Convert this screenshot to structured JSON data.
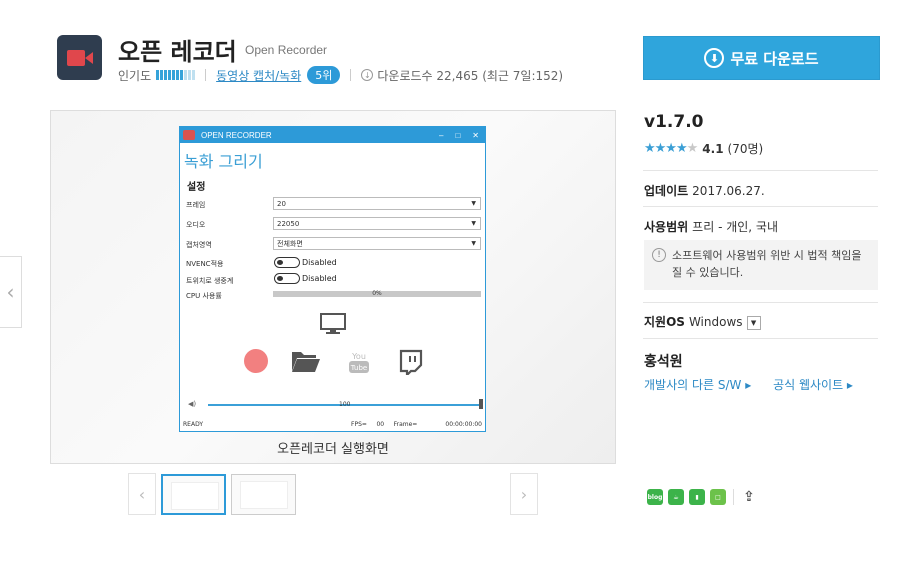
{
  "app": {
    "title": "오픈 레코더",
    "subtitle": "Open Recorder",
    "popularity_label": "인기도",
    "category": "동영상 캡처/녹화",
    "rank": "5위",
    "downloads_label": "다운로드수 22,465 (최근 7일:152)"
  },
  "download_button": {
    "label": "무료 다운로드"
  },
  "screenshot": {
    "caption": "오픈레코더 실행화면",
    "window": {
      "title": "OPEN RECORDER",
      "heading": "녹화 그리기",
      "settings_title": "설정",
      "rows": {
        "frame_label": "프레임",
        "frame_value": "20",
        "audio_label": "오디오",
        "audio_value": "22050",
        "capture_label": "캡처영역",
        "capture_value": "전체화면",
        "nvenc_label": "NVENC적용",
        "nvenc_state": "Disabled",
        "twitch_label": "트위치로 생중계",
        "twitch_state": "Disabled",
        "cpu_label": "CPU 사용률",
        "cpu_value": "0%"
      },
      "volume_value": "100",
      "status": "READY",
      "fps_text": "FPS=     00     Frame=",
      "time": "00:00:00:00"
    }
  },
  "info": {
    "version": "v1.7.0",
    "rating_score": "4.1",
    "rating_count": "(70명)",
    "rating_value": 4.1,
    "update_label": "업데이트",
    "update_date": "2017.06.27.",
    "license_label": "사용범위",
    "license_value": "프리 - 개인, 국내",
    "warning": "소프트웨어 사용범위 위반 시 법적 책임을 질 수 있습니다.",
    "os_label": "지원OS",
    "os_value": "Windows",
    "developer": "홍석원",
    "dev_link_sw": "개발사의 다른 S/W ▸",
    "dev_link_site": "공식 웹사이트 ▸"
  },
  "colors": {
    "accent": "#2fa5dc",
    "link": "#2d89c5",
    "record": "#f28080"
  }
}
